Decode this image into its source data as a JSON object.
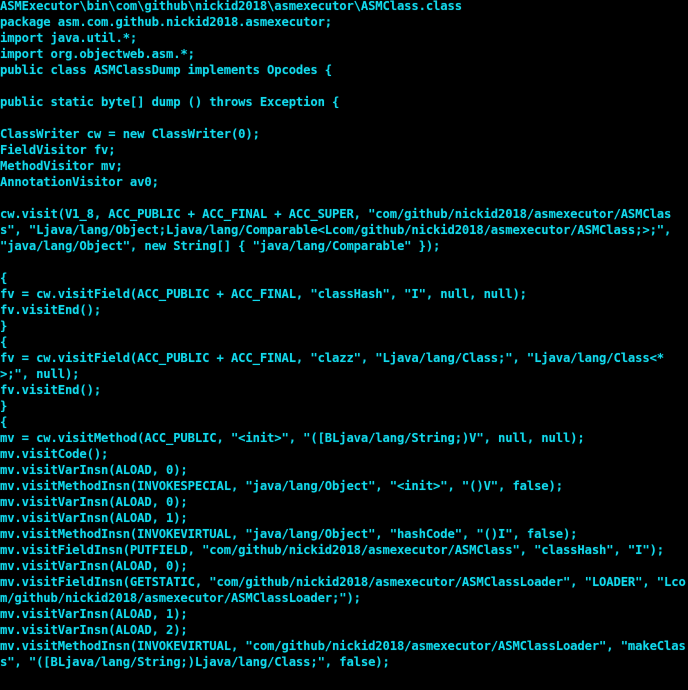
{
  "window": {
    "kind": "terminal-console",
    "background_color": "#000000",
    "foreground_color": "#12D9EC",
    "columns": 99,
    "rows": 43
  },
  "console": {
    "lines": [
      "ASMExecutor\\bin\\com\\github\\nickid2018\\asmexecutor\\ASMClass.class",
      "package asm.com.github.nickid2018.asmexecutor;",
      "import java.util.*;",
      "import org.objectweb.asm.*;",
      "public class ASMClassDump implements Opcodes {",
      "",
      "public static byte[] dump () throws Exception {",
      "",
      "ClassWriter cw = new ClassWriter(0);",
      "FieldVisitor fv;",
      "MethodVisitor mv;",
      "AnnotationVisitor av0;",
      "",
      "cw.visit(V1_8, ACC_PUBLIC + ACC_FINAL + ACC_SUPER, \"com/github/nickid2018/asmexecutor/ASMClass\", \"Ljava/lang/Object;Ljava/lang/Comparable<Lcom/github/nickid2018/asmexecutor/ASMClass;>;\", \"java/lang/Object\", new String[] { \"java/lang/Comparable\" });",
      "",
      "{",
      "fv = cw.visitField(ACC_PUBLIC + ACC_FINAL, \"classHash\", \"I\", null, null);",
      "fv.visitEnd();",
      "}",
      "{",
      "fv = cw.visitField(ACC_PUBLIC + ACC_FINAL, \"clazz\", \"Ljava/lang/Class;\", \"Ljava/lang/Class<*>;\", null);",
      "fv.visitEnd();",
      "}",
      "{",
      "mv = cw.visitMethod(ACC_PUBLIC, \"<init>\", \"([BLjava/lang/String;)V\", null, null);",
      "mv.visitCode();",
      "mv.visitVarInsn(ALOAD, 0);",
      "mv.visitMethodInsn(INVOKESPECIAL, \"java/lang/Object\", \"<init>\", \"()V\", false);",
      "mv.visitVarInsn(ALOAD, 0);",
      "mv.visitVarInsn(ALOAD, 1);",
      "mv.visitMethodInsn(INVOKEVIRTUAL, \"java/lang/Object\", \"hashCode\", \"()I\", false);",
      "mv.visitFieldInsn(PUTFIELD, \"com/github/nickid2018/asmexecutor/ASMClass\", \"classHash\", \"I\");",
      "mv.visitVarInsn(ALOAD, 0);",
      "mv.visitFieldInsn(GETSTATIC, \"com/github/nickid2018/asmexecutor/ASMClassLoader\", \"LOADER\", \"Lcom/github/nickid2018/asmexecutor/ASMClassLoader;\");",
      "mv.visitVarInsn(ALOAD, 1);",
      "mv.visitVarInsn(ALOAD, 2);",
      "mv.visitMethodInsn(INVOKEVIRTUAL, \"com/github/nickid2018/asmexecutor/ASMClassLoader\", \"makeClass\", \"([BLjava/lang/String;)Ljava/lang/Class;\", false);"
    ]
  }
}
